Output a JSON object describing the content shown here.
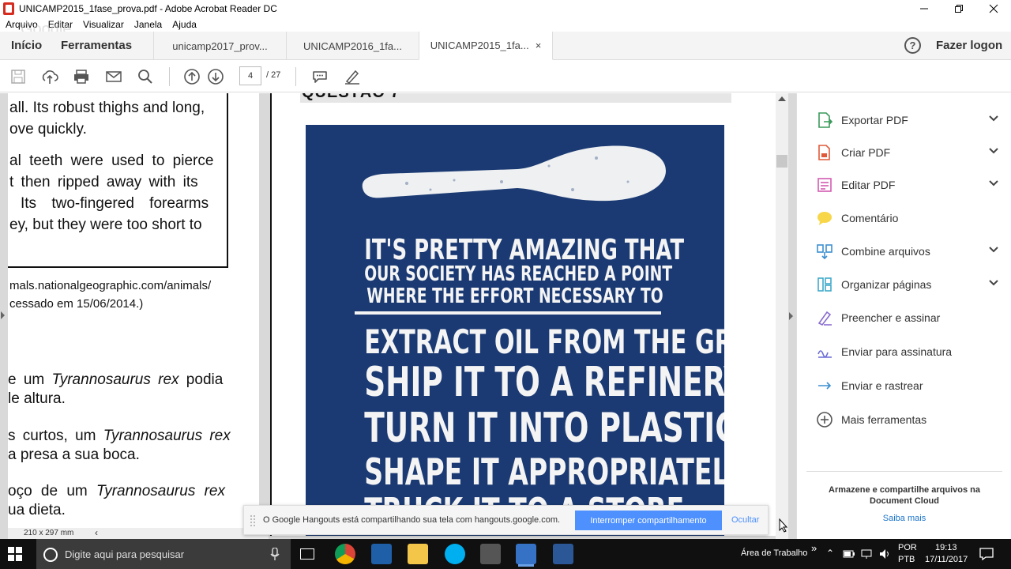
{
  "window": {
    "title": "UNICAMP2015_1fase_prova.pdf - Adobe Acrobat Reader DC"
  },
  "menu": [
    "Arquivo",
    "Editar",
    "Visualizar",
    "Janela",
    "Ajuda"
  ],
  "watermark": "Google",
  "nav": {
    "home": "Início",
    "tools": "Ferramentas",
    "login": "Fazer logon"
  },
  "tabs": [
    {
      "label": "unicamp2017_prov...",
      "active": false
    },
    {
      "label": "UNICAMP2016_1fa...",
      "active": false
    },
    {
      "label": "UNICAMP2015_1fa...",
      "active": true,
      "close": "×"
    }
  ],
  "toolbar": {
    "page_current": "4",
    "page_sep_total": "/ 27"
  },
  "left_page": {
    "lines": [
      "all. Its robust thighs and long,",
      "ove quickly.",
      "al teeth were used to pierce",
      "t then ripped away with its",
      "Its two-fingered forearms",
      "ey, but they were too short to",
      "mals.nationalgeographic.com/animals/",
      "cessado em 15/06/2014.)"
    ],
    "options": [
      {
        "pre": "e um ",
        "em": "Tyrannosaurus rex",
        "post": " podia"
      },
      {
        "pre": "le altura.",
        "em": "",
        "post": ""
      },
      {
        "pre": "s curtos, um ",
        "em": "Tyrannosaurus rex",
        "post": ""
      },
      {
        "pre": "a presa a sua boca.",
        "em": "",
        "post": ""
      },
      {
        "pre": "oço de um ",
        "em": "Tyrannosaurus rex",
        "post": ""
      },
      {
        "pre": "ua dieta.",
        "em": "",
        "post": ""
      }
    ]
  },
  "main_page": {
    "heading": "QUESTÃO 7",
    "poster_lines": [
      "IT'S PRETTY AMAZING THAT",
      "OUR SOCIETY HAS REACHED A POINT",
      "WHERE THE EFFORT NECESSARY TO",
      "EXTRACT OIL FROM THE GROUND,",
      "SHIP IT TO A REFINERY,",
      "TURN IT INTO PLASTIC,",
      "SHAPE IT APPROPRIATELY,",
      "TRUCK IT TO A STORE"
    ]
  },
  "status": {
    "page_size": "210 x 297 mm"
  },
  "hangouts": {
    "message": "O Google Hangouts está compartilhando sua tela com hangouts.google.com.",
    "stop": "Interromper compartilhamento",
    "hide": "Ocultar"
  },
  "right_panel": {
    "items": [
      {
        "label": "Exportar PDF",
        "expand": true
      },
      {
        "label": "Criar PDF",
        "expand": true
      },
      {
        "label": "Editar PDF",
        "expand": true
      },
      {
        "label": "Comentário",
        "expand": false
      },
      {
        "label": "Combine arquivos",
        "expand": true
      },
      {
        "label": "Organizar páginas",
        "expand": true
      },
      {
        "label": "Preencher e assinar",
        "expand": false
      },
      {
        "label": "Enviar para assinatura",
        "expand": false
      },
      {
        "label": "Enviar e rastrear",
        "expand": false
      },
      {
        "label": "Mais ferramentas",
        "expand": false
      }
    ],
    "cloud_text": "Armazene e compartilhe arquivos na Document Cloud",
    "cloud_link": "Saiba mais"
  },
  "taskbar": {
    "search_placeholder": "Digite aqui para pesquisar",
    "desktop_label": "Área de Trabalho",
    "lang1": "POR",
    "lang2": "PTB",
    "time": "19:13",
    "date": "17/11/2017"
  }
}
